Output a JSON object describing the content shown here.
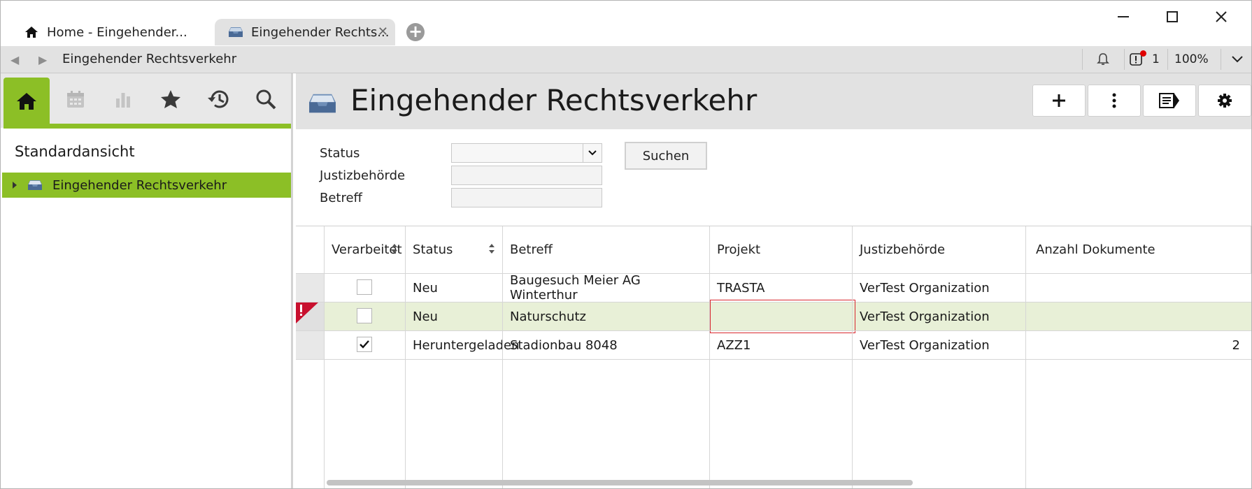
{
  "tabs": [
    {
      "label": "Home - Eingehender...",
      "icon": "home-icon"
    },
    {
      "label": "Eingehender Rechts...",
      "icon": "inbox-tray-icon"
    }
  ],
  "addressbar": {
    "title": "Eingehender Rechtsverkehr",
    "notification_count": "1",
    "zoom": "100%"
  },
  "sidebar": {
    "view_title": "Standardansicht",
    "tree_item": "Eingehender Rechtsverkehr",
    "accent_color": "#8cbf26"
  },
  "main": {
    "title": "Eingehender Rechtsverkehr"
  },
  "filters": {
    "status_label": "Status",
    "status_value": "",
    "authority_label": "Justizbehörde",
    "authority_value": "",
    "subject_label": "Betreff",
    "subject_value": "",
    "search_button": "Suchen"
  },
  "grid": {
    "columns": [
      "Verarbeitet",
      "Status",
      "Betreff",
      "Projekt",
      "Justizbehörde",
      "Anzahl Dokumente"
    ],
    "rows": [
      {
        "processed": false,
        "status": "Neu",
        "subject": "Baugesuch Meier AG Winterthur",
        "project": "TRASTA",
        "authority": "VerTest Organization",
        "doc_count": "",
        "error": false
      },
      {
        "processed": false,
        "status": "Neu",
        "subject": "Naturschutz",
        "project": "",
        "authority": "VerTest Organization",
        "doc_count": "",
        "error": true
      },
      {
        "processed": true,
        "status": "Heruntergeladen",
        "subject": "Stadionbau 8048",
        "project": "AZZ1",
        "authority": "VerTest Organization",
        "doc_count": "2",
        "error": false
      }
    ],
    "selected_row_color": "#e8f0d7",
    "error_color": "#c8102e"
  }
}
